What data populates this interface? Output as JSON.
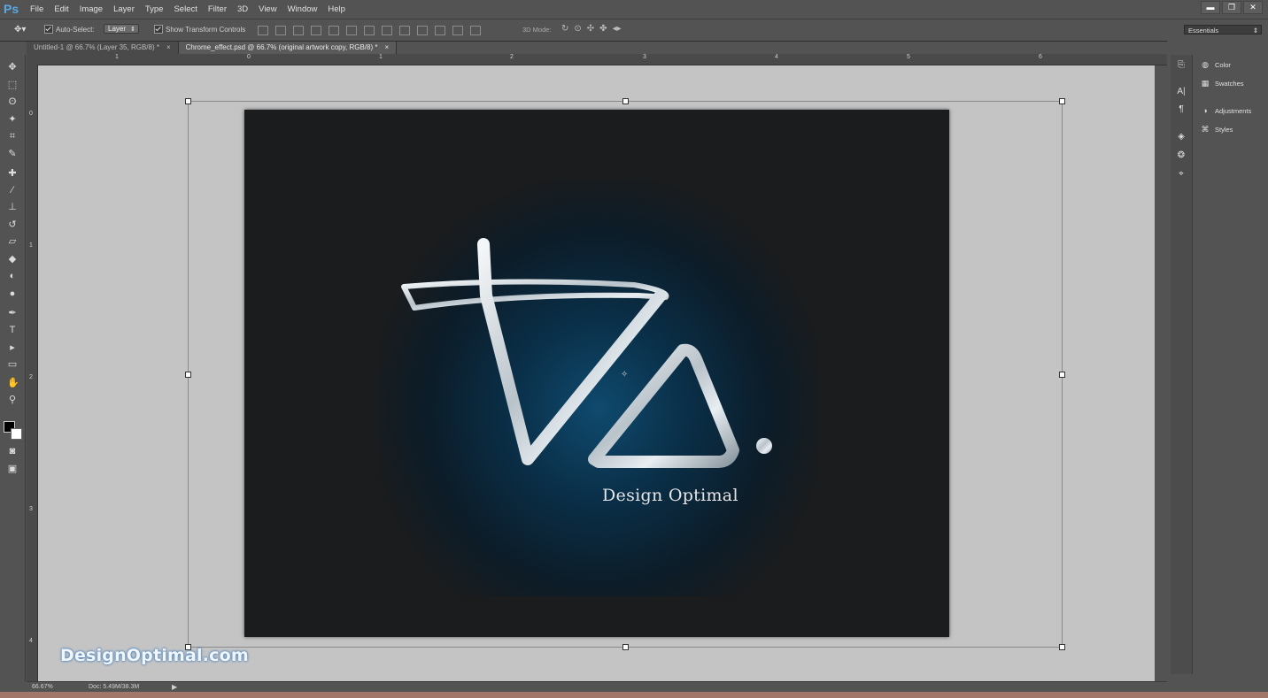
{
  "app": {
    "logo": "Ps"
  },
  "menu": [
    "File",
    "Edit",
    "Image",
    "Layer",
    "Type",
    "Select",
    "Filter",
    "3D",
    "View",
    "Window",
    "Help"
  ],
  "window_controls": {
    "minimize": "▬",
    "restore": "❐",
    "close": "✕"
  },
  "options": {
    "auto_select_label": "Auto-Select:",
    "auto_select_value": "Layer",
    "show_transform_label": "Show Transform Controls",
    "mode_3d_label": "3D Mode:",
    "workspace": "Essentials"
  },
  "tabs": [
    {
      "label": "Untitled-1 @ 66.7% (Layer 35, RGB/8) *",
      "close": "×"
    },
    {
      "label": "Chrome_effect.psd @ 66.7% (original artwork copy, RGB/8) *",
      "close": "×"
    }
  ],
  "rulers": {
    "top": [
      "1",
      "0",
      "1",
      "2",
      "3",
      "4",
      "5",
      "6"
    ],
    "left": [
      "0",
      "1",
      "2",
      "3",
      "4"
    ]
  },
  "artwork": {
    "tagline": "Design Optimal",
    "watermark": "DesignOptimal.com"
  },
  "status": {
    "zoom": "66.67%",
    "doc": "Doc: 5.49M/38.3M"
  },
  "panels": [
    {
      "name": "Color",
      "icon": "palette-icon"
    },
    {
      "name": "Swatches",
      "icon": "grid-icon"
    },
    {
      "name": "Adjustments",
      "icon": "adjust-icon"
    },
    {
      "name": "Styles",
      "icon": "fx-icon"
    }
  ],
  "colors": {
    "ps_blue": "#59a9e6",
    "glow": "#0f4a6e",
    "artboard": "#1b1c1d",
    "pasteboard": "#c4c4c4"
  }
}
